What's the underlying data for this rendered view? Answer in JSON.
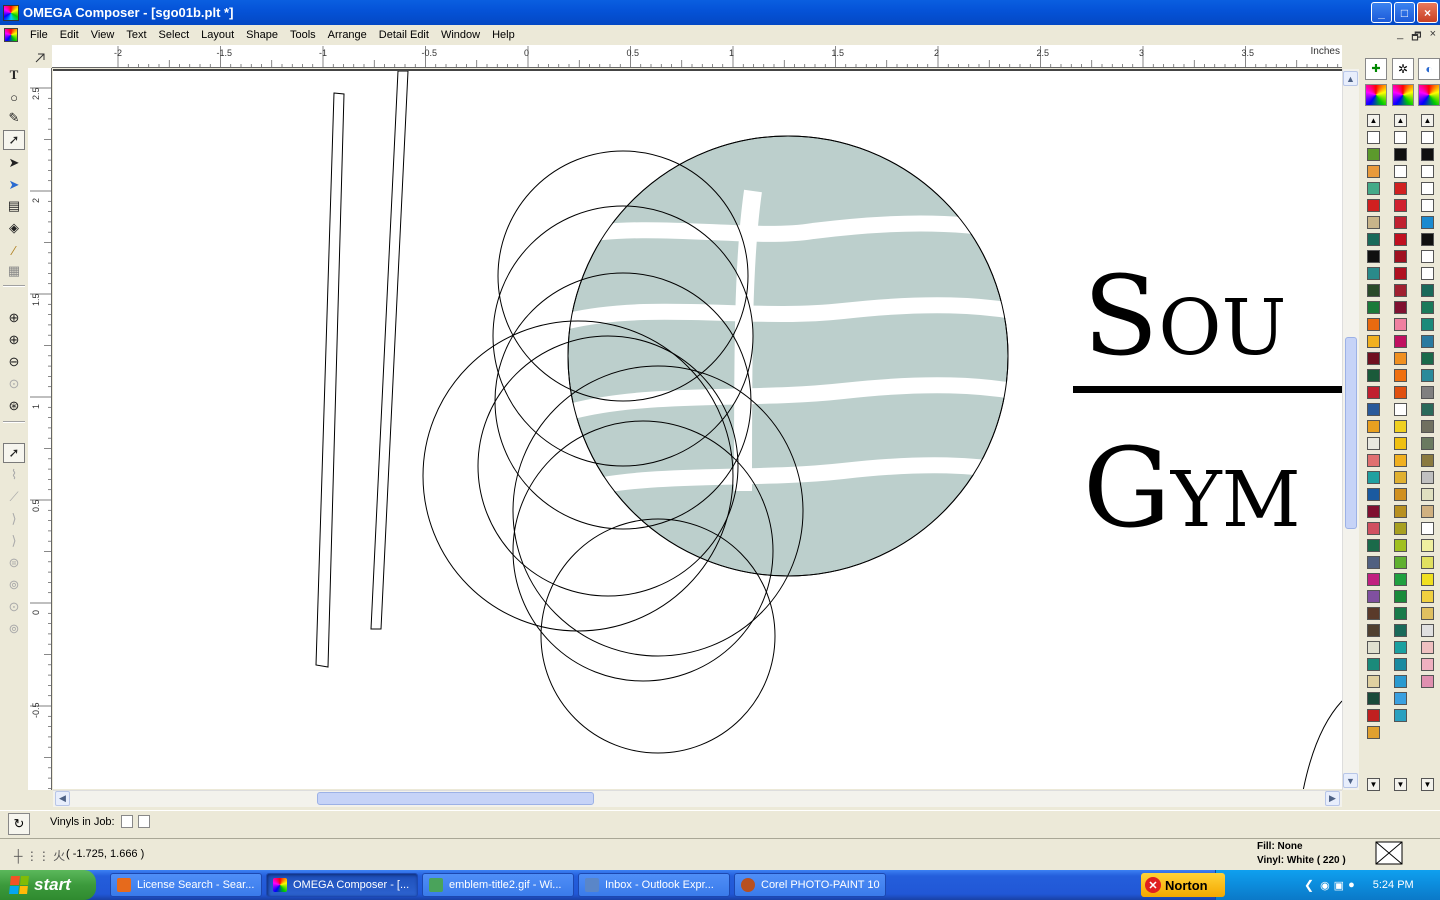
{
  "window": {
    "title": "OMEGA Composer - [sgo01b.plt *]",
    "buttons": {
      "minimize": "_",
      "maximize": "□",
      "close": "×"
    }
  },
  "menu": [
    "File",
    "Edit",
    "View",
    "Text",
    "Select",
    "Layout",
    "Shape",
    "Tools",
    "Arrange",
    "Detail Edit",
    "Window",
    "Help"
  ],
  "mdi_buttons": [
    "_",
    "🗗",
    "×"
  ],
  "ruler": {
    "unit": "Inches",
    "top_ticks": [
      "-2",
      "-1.5",
      "-1",
      "-0.5",
      "0",
      "0.5",
      "1",
      "1.5",
      "2",
      "2.5",
      "3",
      "3.5"
    ],
    "left_ticks": [
      "2.5",
      "2",
      "1.5",
      "1",
      "0.5",
      "0",
      "-0.5"
    ]
  },
  "canvas": {
    "text_line1": "Sou",
    "text_line2": "Gym",
    "leaf_fill": "#bccfcc"
  },
  "toolbox": {
    "tools": [
      "text-tool",
      "shape-tool",
      "pen-tool",
      "node-edit-tool",
      "select-tool",
      "direct-select-tool",
      "measure-tool",
      "fill-tool",
      "eyedropper-tool",
      "fill-pattern-tool",
      "zoom-tool",
      "zoom-in-tool",
      "zoom-out-tool",
      "zoom-previous-tool",
      "zoom-fit-tool",
      "detail-select-tool",
      "detail-tool-1",
      "detail-tool-2",
      "detail-tool-3",
      "detail-tool-4",
      "detail-tool-5",
      "detail-tool-6",
      "detail-tool-7",
      "detail-tool-8"
    ]
  },
  "status": {
    "vinyls_label": "Vinyls in Job:",
    "coords": "( -1.725, 1.666 )",
    "fill": "Fill: None",
    "vinyl": "Vinyl: White ( 220 )"
  },
  "taskbar": {
    "start": "start",
    "tasks": [
      {
        "label": "License Search - Sear...",
        "icon": "firefox-icon",
        "color": "#e66a1c"
      },
      {
        "label": "OMEGA Composer - [...",
        "icon": "omega-icon",
        "color": "#d94a8c",
        "active": true
      },
      {
        "label": "emblem-title2.gif - Wi...",
        "icon": "image-viewer-icon",
        "color": "#4aa35b"
      },
      {
        "label": "Inbox - Outlook Expr...",
        "icon": "outlook-icon",
        "color": "#5a86c8"
      },
      {
        "label": "Corel PHOTO-PAINT 10",
        "icon": "corel-icon",
        "color": "#b85020"
      }
    ],
    "norton": "Norton",
    "clock": "5:24 PM"
  },
  "palette": {
    "col1": [
      "#ffffff",
      "#5c9a2c",
      "#e89a3c",
      "#44aa88",
      "#d02020",
      "#c8b48a",
      "#1a6a5a",
      "#101010",
      "#2a8a8a",
      "#2a4a2a",
      "#1a7a3a",
      "#e86a10",
      "#f0b020",
      "#701020",
      "#1a5a3a",
      "#c02030",
      "#2a5a9a",
      "#e8a020",
      "#e8e8e0",
      "#e07070",
      "#20a0a0",
      "#1a5aa0",
      "#801030",
      "#d05060",
      "#1a6a4a",
      "#506080",
      "#c02080",
      "#8050a0",
      "#5a3a2a",
      "#504030",
      "#e0e0d0",
      "#1a8a7a",
      "#e0d0a0",
      "#1a4a3a",
      "#c02020",
      "#e0a030"
    ],
    "col2": [
      "#ffffff",
      "#101010",
      "#ffffff",
      "#d02020",
      "#d02030",
      "#c02030",
      "#c01020",
      "#a01020",
      "#b01020",
      "#a02030",
      "#801030",
      "#f080a0",
      "#c01060",
      "#f09020",
      "#f07010",
      "#e05010",
      "#ffffff",
      "#f0d020",
      "#f0c010",
      "#f0b020",
      "#e0b030",
      "#d09020",
      "#b89020",
      "#a8a020",
      "#a0c020",
      "#60b030",
      "#20a040",
      "#1a8a3a",
      "#1a7a4a",
      "#1a6a5a",
      "#1aa0a0",
      "#1a8aa0",
      "#2a9ad0",
      "#3aa0e0",
      "#2aa0c0"
    ],
    "col3": [
      "#ffffff",
      "#101010",
      "#ffffff",
      "#ffffff",
      "#ffffff",
      "#1a8ad0",
      "#101010",
      "#ffffff",
      "#ffffff",
      "#1a6a5a",
      "#1a7a5a",
      "#1a8a7a",
      "#2a7aa0",
      "#1a6a4a",
      "#2a8a9a",
      "#808080",
      "#2a6a5a",
      "#707060",
      "#6a7a60",
      "#8a7a40",
      "#c0c0c0",
      "#e0e0c0",
      "#d0b080",
      "#ffffff",
      "#f0f0a0",
      "#e0e060",
      "#f0e020",
      "#f0d040",
      "#e0c060",
      "#e0e0e0",
      "#f0c0c0",
      "#f0b0c0",
      "#e090b0"
    ]
  }
}
